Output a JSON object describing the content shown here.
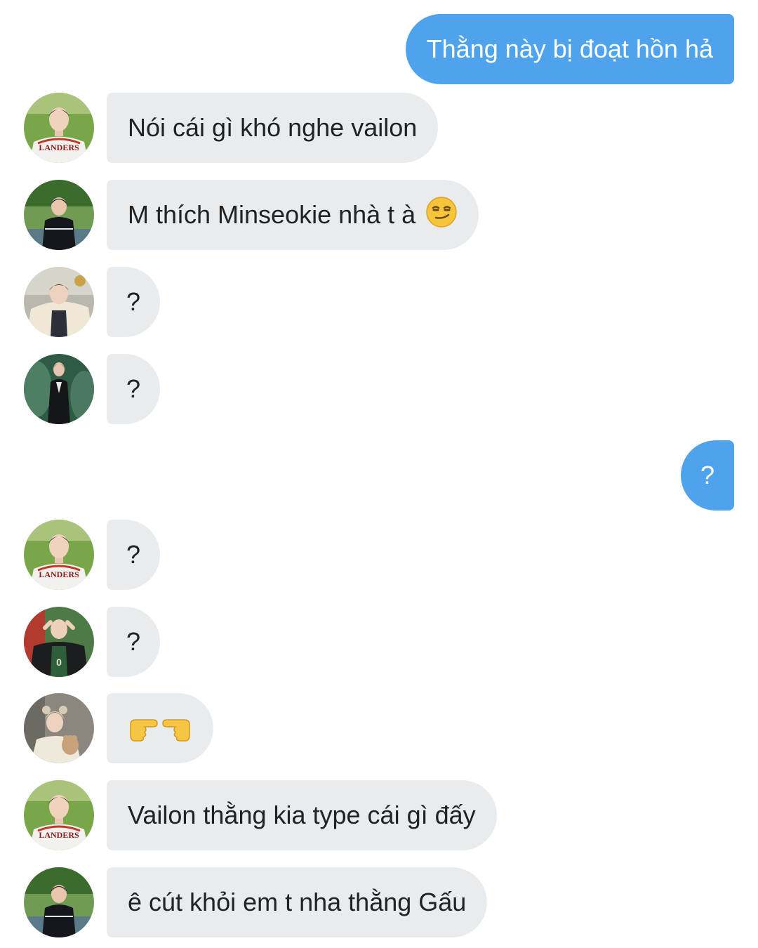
{
  "messages": [
    {
      "side": "out",
      "text": "Thằng này bị đoạt hồn hả"
    },
    {
      "side": "in",
      "avatar": "avatar-baseball-jersey",
      "text": "Nói cái gì khó nghe vailon"
    },
    {
      "side": "in",
      "avatar": "avatar-park-black-jersey",
      "text": "M thích Minseokie nhà t à",
      "emoji": "smirking-face-emoji"
    },
    {
      "side": "in",
      "avatar": "avatar-cream-fleece",
      "text": "?"
    },
    {
      "side": "in",
      "avatar": "avatar-black-suit",
      "text": "?"
    },
    {
      "side": "out",
      "text": "?"
    },
    {
      "side": "in",
      "avatar": "avatar-baseball-jersey",
      "text": "?"
    },
    {
      "side": "in",
      "avatar": "avatar-varsity-jacket",
      "text": "?"
    },
    {
      "side": "in",
      "avatar": "avatar-bear-hat",
      "emoji": "pointing-hands-emoji"
    },
    {
      "side": "in",
      "avatar": "avatar-baseball-jersey",
      "text": "Vailon thằng kia type cái gì đấy"
    },
    {
      "side": "in",
      "avatar": "avatar-park-black-jersey",
      "text": "ê cút khỏi em t nha thằng Gấu"
    }
  ],
  "colors": {
    "incoming_bubble": "#e9ecef",
    "outgoing_bubble": "#4fa3ec",
    "outgoing_text": "#ffffff",
    "incoming_text": "#222222"
  }
}
